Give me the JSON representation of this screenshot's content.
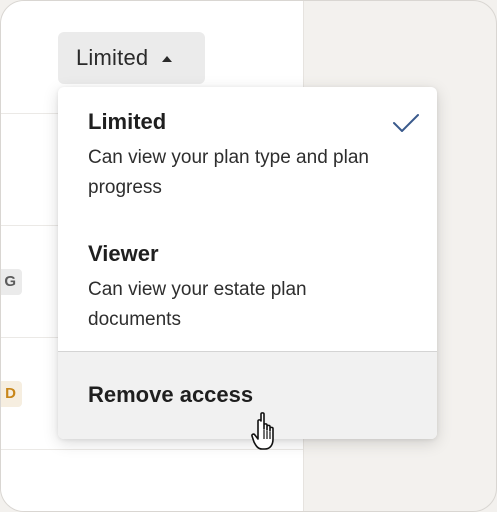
{
  "trigger": {
    "label": "Limited",
    "icon": "caret-up-icon"
  },
  "background_badges": [
    {
      "text": "G",
      "color": "#5c5c5c"
    },
    {
      "text": "D",
      "color": "#c8861a"
    }
  ],
  "menu": {
    "options": [
      {
        "title": "Limited",
        "description": "Can view your plan type and plan progress",
        "selected": true,
        "icon": "checkmark-icon"
      },
      {
        "title": "Viewer",
        "description": "Can view your estate plan documents",
        "selected": false
      }
    ],
    "remove_label": "Remove access"
  },
  "colors": {
    "checkmark": "#3a5a8c",
    "hover_background": "#f1f1f1",
    "trigger_background": "#ebebeb"
  },
  "cursor": "hand-pointer-icon"
}
